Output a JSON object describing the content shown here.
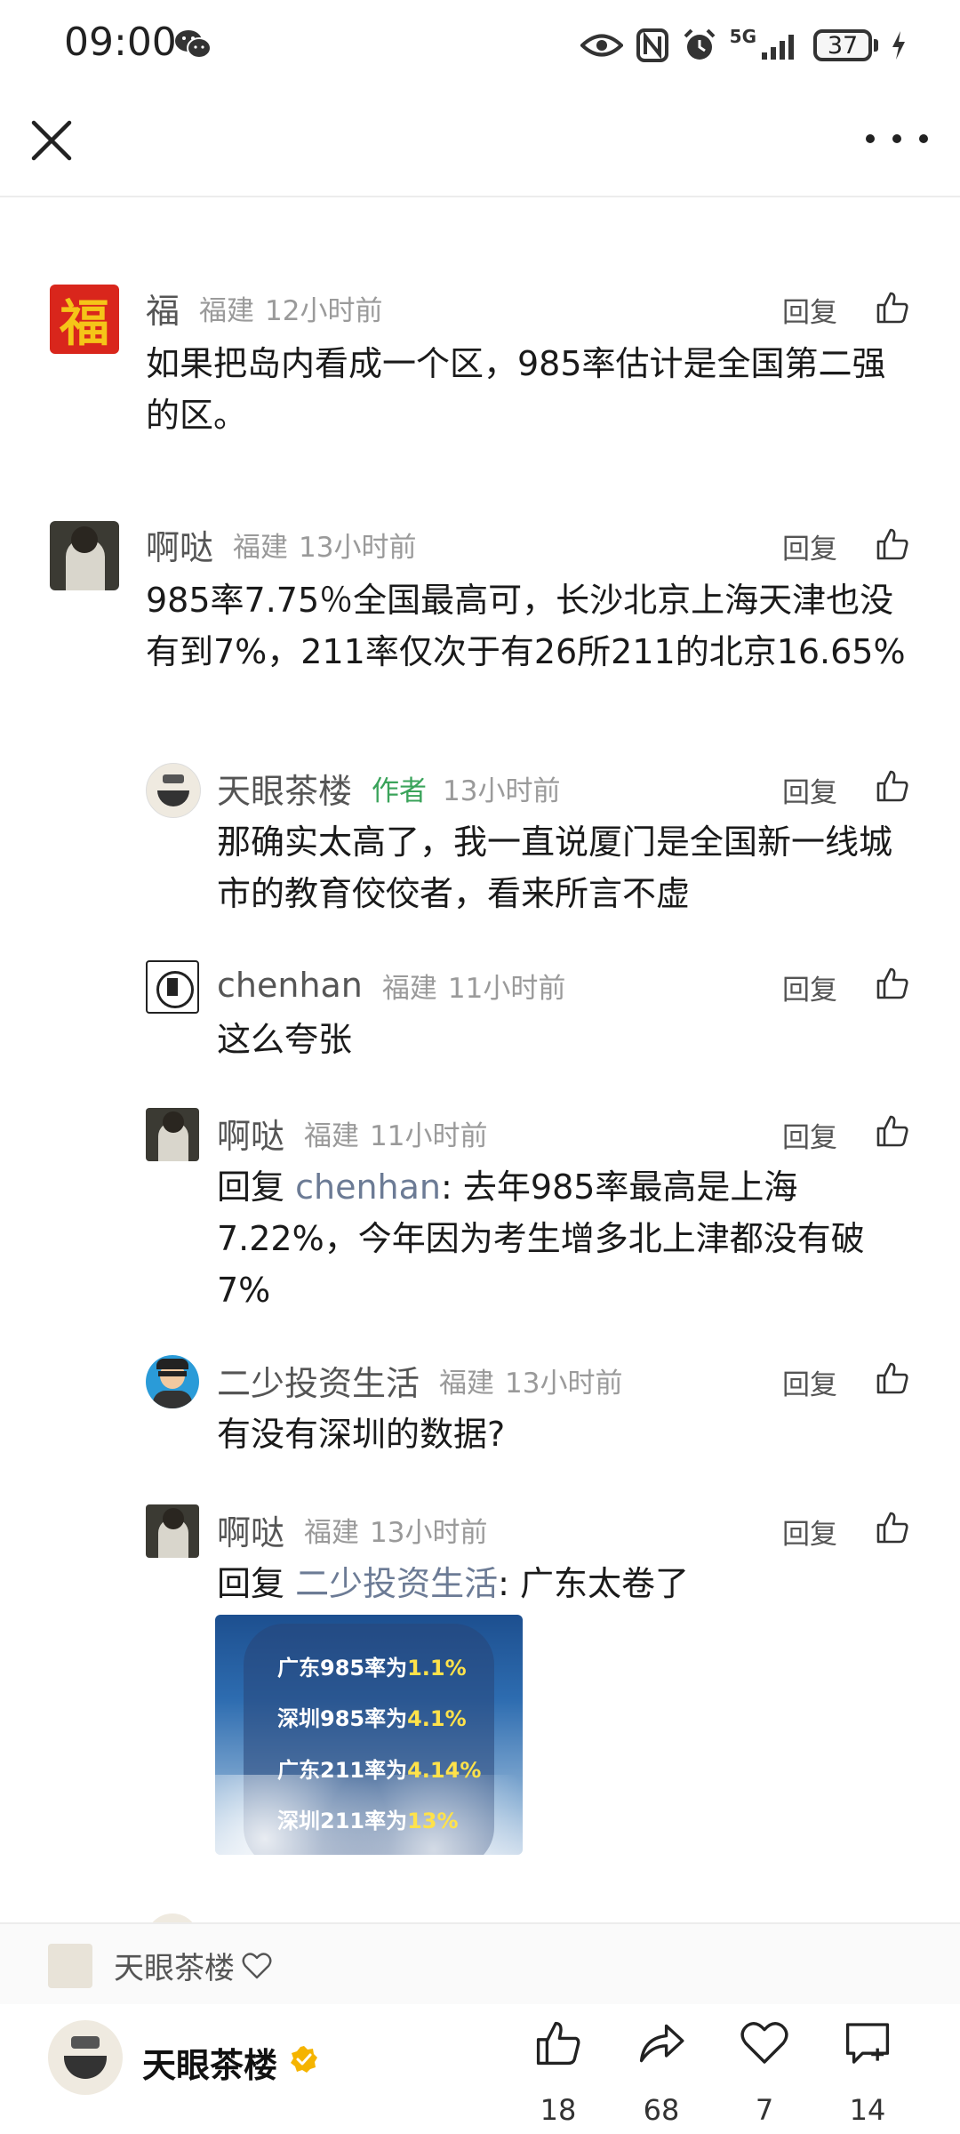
{
  "status": {
    "time": "09:00",
    "network": "5G",
    "battery": "37"
  },
  "comments": [
    {
      "name": "福",
      "location": "福建",
      "time": "12小时前",
      "reply_label": "回复",
      "text": "如果把岛内看成一个区，985率估计是全国第二强的区。",
      "avatar_char": "福"
    },
    {
      "name": "啊哒",
      "location": "福建",
      "time": "13小时前",
      "reply_label": "回复",
      "text": "985率7.75％全国最高可，长沙北京上海天津也没有到7%，211率仅次于有26所211的北京16.65%"
    }
  ],
  "replies": [
    {
      "name": "天眼茶楼",
      "author_tag": "作者",
      "time": "13小时前",
      "reply_label": "回复",
      "text": "那确实太高了，我一直说厦门是全国新一线城市的教育佼佼者，看来所言不虚"
    },
    {
      "name": "chenhan",
      "location": "福建",
      "time": "11小时前",
      "reply_label": "回复",
      "text": "这么夸张"
    },
    {
      "name": "啊哒",
      "location": "福建",
      "time": "11小时前",
      "reply_label": "回复",
      "prefix": "回复 ",
      "mention": "chenhan",
      "text": "去年985率最高是上海7.22%，今年因为考生增多北上津都没有破7%"
    },
    {
      "name": "二少投资生活",
      "location": "福建",
      "time": "13小时前",
      "reply_label": "回复",
      "text": "有没有深圳的数据?"
    },
    {
      "name": "啊哒",
      "location": "福建",
      "time": "13小时前",
      "reply_label": "回复",
      "prefix": "回复 ",
      "mention": "二少投资生活",
      "text": "广东太卷了"
    }
  ],
  "infocard": [
    {
      "label": "广东985率为",
      "value": "1.1%"
    },
    {
      "label": "深圳985率为",
      "value": "4.1%"
    },
    {
      "label": "广东211率为",
      "value": "4.14%"
    },
    {
      "label": "深圳211率为",
      "value": "13%"
    }
  ],
  "follow": {
    "name": "天眼茶楼"
  },
  "bottom": {
    "author_name": "天眼茶楼",
    "likes": "18",
    "shares": "68",
    "favorites": "7",
    "comments": "14"
  },
  "colors": {
    "accent_green": "#3aa35a",
    "mention": "#6c7b95",
    "highlight_yellow": "#ffe24a",
    "verified": "#f5b400"
  }
}
